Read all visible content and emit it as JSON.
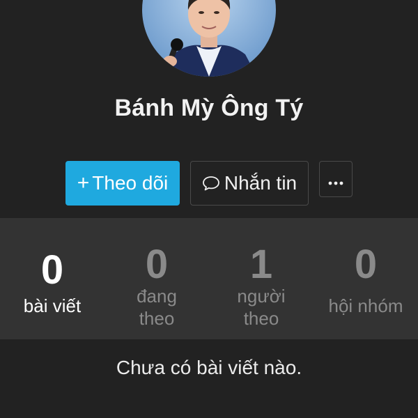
{
  "profile": {
    "name": "Bánh Mỳ Ông Tý"
  },
  "actions": {
    "follow_label": "Theo dõi",
    "follow_prefix": "+",
    "message_label": "Nhắn tin",
    "more_label": "···"
  },
  "stats": [
    {
      "value": "0",
      "label": "bài viết",
      "active": true
    },
    {
      "value": "0",
      "label": "đang\ntheo",
      "active": false
    },
    {
      "value": "1",
      "label": "người\ntheo",
      "active": false
    },
    {
      "value": "0",
      "label": "hội nhóm",
      "active": false
    }
  ],
  "empty_state": {
    "text": "Chưa có bài viết nào."
  },
  "colors": {
    "background": "#222222",
    "stats_background": "#333333",
    "accent": "#1fa9df",
    "muted_text": "#8a8a8a"
  },
  "icons": {
    "message": "speech-bubble-icon",
    "more": "ellipsis-icon"
  }
}
